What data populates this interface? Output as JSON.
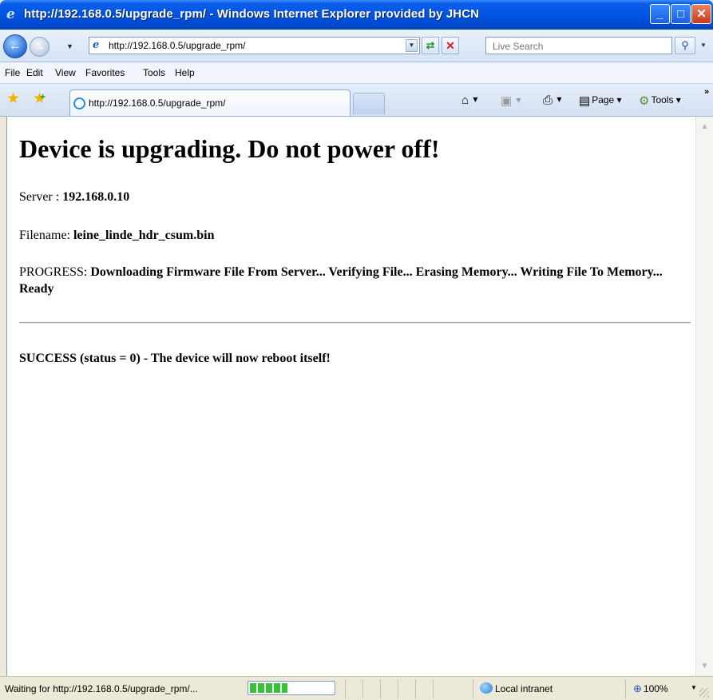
{
  "window": {
    "title": "http://192.168.0.5/upgrade_rpm/ - Windows Internet Explorer provided by JHCN",
    "controls": {
      "minimize": "_",
      "maximize": "□",
      "close": "✕"
    }
  },
  "nav": {
    "address": "http://192.168.0.5/upgrade_rpm/",
    "search_placeholder": "Live Search"
  },
  "menu": {
    "items": [
      "File",
      "Edit",
      "View",
      "Favorites",
      "Tools",
      "Help"
    ]
  },
  "tabs": {
    "active_label": "http://192.168.0.5/upgrade_rpm/"
  },
  "command_bar": {
    "page_label": "Page",
    "tools_label": "Tools"
  },
  "page": {
    "heading": "Device is upgrading. Do not power off!",
    "server_label": "Server : ",
    "server_value": "192.168.0.10",
    "filename_label": "Filename: ",
    "filename_value": "leine_linde_hdr_csum.bin",
    "progress_label": "PROGRESS: ",
    "progress_value": "Downloading Firmware File From Server... Verifying File... Erasing Memory... Writing File To Memory... Ready",
    "result": "SUCCESS (status = 0) - The device will now reboot itself!"
  },
  "status_bar": {
    "text": "Waiting for http://192.168.0.5/upgrade_rpm/...",
    "progress_fraction": 0.45,
    "zone": "Local intranet",
    "zoom": "100%"
  },
  "colors": {
    "titlebar": "#0054E3",
    "progress_fill": "#36C236",
    "close_button": "#C6391B"
  }
}
